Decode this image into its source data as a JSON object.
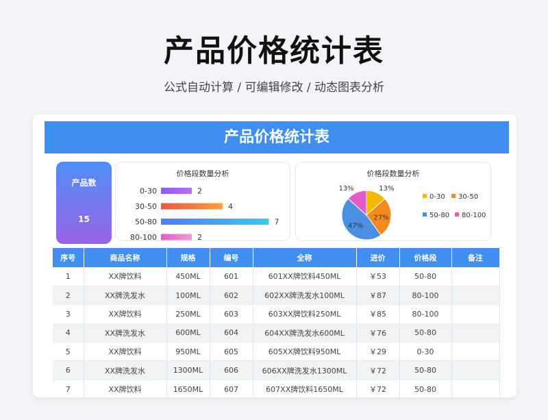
{
  "header": {
    "title": "产品价格统计表",
    "subtitle": "公式自动计算 /  可编辑修改  / 动态图表分析"
  },
  "card": {
    "banner_title": "产品价格统计表",
    "product_count_label": "产品数",
    "product_count_value": "15"
  },
  "colors": {
    "accent": "#3f8ef0",
    "slice_0_30": "#f5b800",
    "slice_30_50": "#f58b1f",
    "slice_50_80": "#4a90e2",
    "slice_80_100": "#e25bc9"
  },
  "chart_data": [
    {
      "type": "bar",
      "orientation": "horizontal",
      "title": "价格段数量分析",
      "categories": [
        "0-30",
        "30-50",
        "50-80",
        "80-100"
      ],
      "values": [
        2,
        4,
        7,
        2
      ]
    },
    {
      "type": "pie",
      "title": "价格段数量分析",
      "categories": [
        "0-30",
        "30-50",
        "50-80",
        "80-100"
      ],
      "values": [
        2,
        4,
        7,
        2
      ],
      "percent_labels": [
        "13%",
        "27%",
        "47%",
        "13%"
      ],
      "legend": "right"
    }
  ],
  "table": {
    "columns": [
      "序号",
      "商品名称",
      "规格",
      "编号",
      "全称",
      "进价",
      "价格段",
      "备注"
    ],
    "rows": [
      [
        "1",
        "XX牌饮料",
        "450ML",
        "601",
        "601XX牌饮料450ML",
        "￥53",
        "50-80",
        ""
      ],
      [
        "2",
        "XX牌洗发水",
        "100ML",
        "602",
        "602XX牌洗发水100ML",
        "￥87",
        "80-100",
        ""
      ],
      [
        "3",
        "XX牌饮料",
        "250ML",
        "603",
        "603XX牌饮料250ML",
        "￥85",
        "80-100",
        ""
      ],
      [
        "4",
        "XX牌洗发水",
        "600ML",
        "604",
        "604XX牌洗发水600ML",
        "￥76",
        "50-80",
        ""
      ],
      [
        "5",
        "XX牌饮料",
        "950ML",
        "605",
        "605XX牌饮料950ML",
        "￥29",
        "0-30",
        ""
      ],
      [
        "6",
        "XX牌洗发水",
        "1300ML",
        "606",
        "606XX牌洗发水1300ML",
        "￥72",
        "50-80",
        ""
      ],
      [
        "7",
        "XX牌饮料",
        "1650ML",
        "607",
        "607XX牌饮料1650ML",
        "￥72",
        "50-80",
        ""
      ]
    ]
  }
}
